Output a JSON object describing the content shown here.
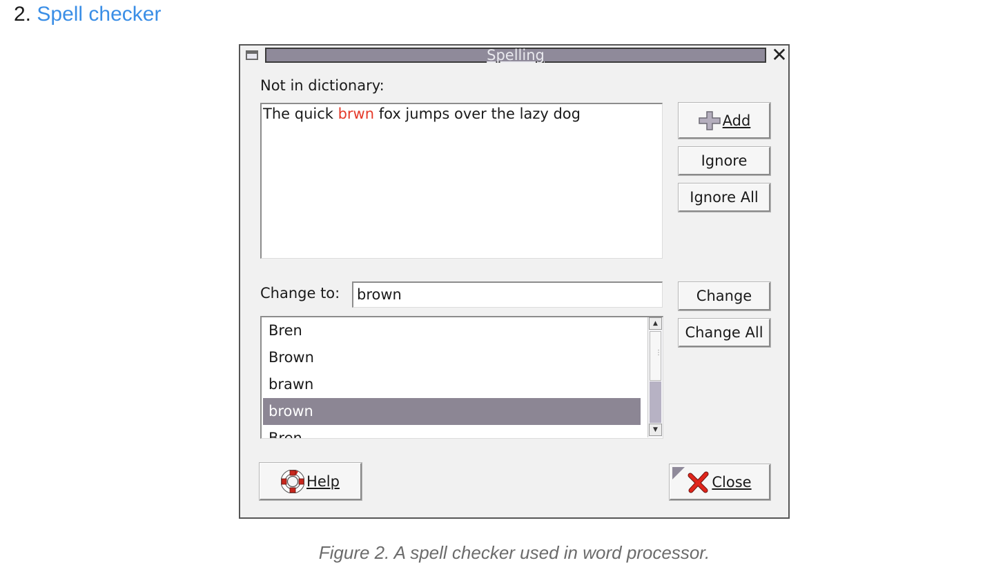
{
  "heading": {
    "number": "2.",
    "link": "Spell checker"
  },
  "dialog": {
    "title": "Spelling",
    "not_in_dictionary_label": "Not in dictionary:",
    "sentence": {
      "before": "The quick ",
      "misspelled": "brwn",
      "after": " fox jumps over the lazy dog"
    },
    "change_to_label": "Change to:",
    "change_to_value": "brown",
    "suggestions": [
      "Bren",
      "Brown",
      "brawn",
      "brown",
      "Bren"
    ],
    "selected_index": 3,
    "buttons": {
      "add": "Add",
      "ignore": "Ignore",
      "ignore_all": "Ignore All",
      "change": "Change",
      "change_all": "Change All",
      "help": "Help",
      "close": "Close"
    },
    "colors": {
      "misspelled": "#e53a2a",
      "selection": "#8c8694",
      "titlebar": "#8f8a9a",
      "link": "#3a8ee6"
    }
  },
  "caption": "Figure 2. A spell checker used in word processor."
}
